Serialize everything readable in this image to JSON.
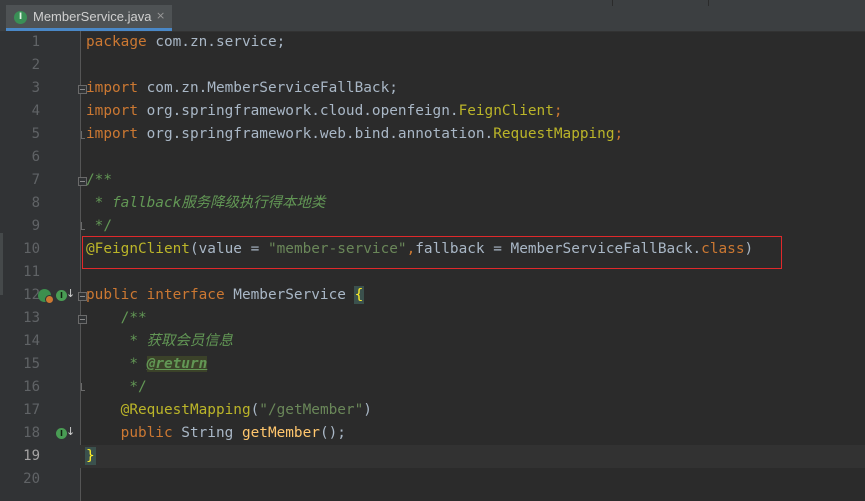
{
  "tab": {
    "icon": "java-interface-icon",
    "title": "MemberService.java",
    "close": "×"
  },
  "lines": {
    "n1": "1",
    "n2": "2",
    "n3": "3",
    "n4": "4",
    "n5": "5",
    "n6": "6",
    "n7": "7",
    "n8": "8",
    "n9": "9",
    "n10": "10",
    "n11": "11",
    "n12": "12",
    "n13": "13",
    "n14": "14",
    "n15": "15",
    "n16": "16",
    "n17": "17",
    "n18": "18",
    "n19": "19",
    "n20": "20"
  },
  "code": {
    "l1_kw": "package",
    "l1_rest": " com.zn.service;",
    "l3_kw": "import",
    "l3_rest": " com.zn.MemberServiceFallBack;",
    "l4_kw": "import",
    "l4_rest": " org.springframework.cloud.openfeign.",
    "l4_ann": "FeignClient",
    "l4_end": ";",
    "l5_kw": "import",
    "l5_rest": " org.springframework.web.bind.annotation.",
    "l5_ann": "RequestMapping",
    "l5_end": ";",
    "l7": "/**",
    "l8": " * fallback服务降级执行得本地类",
    "l9": " */",
    "l10_ann": "@FeignClient",
    "l10_a": "(value = ",
    "l10_str": "\"member-service\"",
    "l10_b": ",",
    "l10_c": "fallback",
    "l10_d": " = MemberServiceFallBack.",
    "l10_kw": "class",
    "l10_e": ")",
    "l12_kw1": "public",
    "l12_kw2": " interface",
    "l12_name": " MemberService ",
    "l12_brace": "{",
    "l13": "    /**",
    "l14": "     * 获取会员信息",
    "l15_pre": "     * ",
    "l15_tag": "@return",
    "l16": "     */",
    "l17_ann": "    @RequestMapping",
    "l17_a": "(",
    "l17_str": "\"/getMember\"",
    "l17_b": ")",
    "l18_kw": "    public",
    "l18_a": " String ",
    "l18_fn": "getMember",
    "l18_b": "();",
    "l19_brace": "}"
  }
}
